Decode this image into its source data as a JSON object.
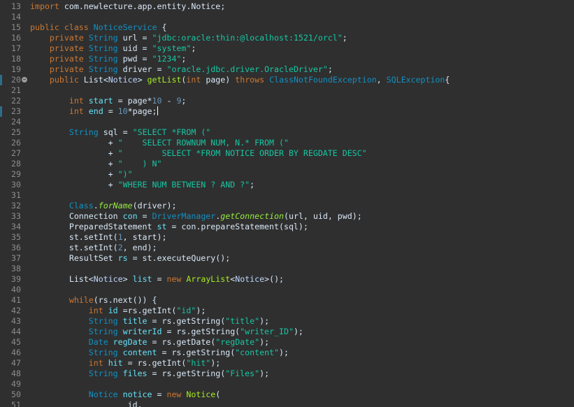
{
  "lines": [
    {
      "n": "13",
      "segs": [
        {
          "t": "import ",
          "c": "kw"
        },
        {
          "t": "com.newlecture.app.entity.Notice;",
          "c": ""
        }
      ]
    },
    {
      "n": "14",
      "segs": []
    },
    {
      "n": "15",
      "segs": [
        {
          "t": "public class ",
          "c": "kw"
        },
        {
          "t": "NoticeService",
          "c": "ty"
        },
        {
          "t": " {",
          "c": ""
        }
      ]
    },
    {
      "n": "16",
      "segs": [
        {
          "t": "    private ",
          "c": "kw"
        },
        {
          "t": "String",
          "c": "ty"
        },
        {
          "t": " url = ",
          "c": ""
        },
        {
          "t": "\"jdbc:oracle:thin:@localhost:1521/orcl\"",
          "c": "str"
        },
        {
          "t": ";",
          "c": ""
        }
      ]
    },
    {
      "n": "17",
      "segs": [
        {
          "t": "    private ",
          "c": "kw"
        },
        {
          "t": "String",
          "c": "ty"
        },
        {
          "t": " uid = ",
          "c": ""
        },
        {
          "t": "\"system\"",
          "c": "str"
        },
        {
          "t": ";",
          "c": ""
        }
      ]
    },
    {
      "n": "18",
      "segs": [
        {
          "t": "    private ",
          "c": "kw"
        },
        {
          "t": "String",
          "c": "ty"
        },
        {
          "t": " pwd = ",
          "c": ""
        },
        {
          "t": "\"1234\"",
          "c": "str"
        },
        {
          "t": ";",
          "c": ""
        }
      ]
    },
    {
      "n": "19",
      "segs": [
        {
          "t": "    private ",
          "c": "kw"
        },
        {
          "t": "String",
          "c": "ty"
        },
        {
          "t": " driver = ",
          "c": ""
        },
        {
          "t": "\"oracle.jdbc.driver.OracleDriver\"",
          "c": "str"
        },
        {
          "t": ";",
          "c": ""
        }
      ]
    },
    {
      "n": "20",
      "segs": [
        {
          "t": "    public ",
          "c": "kw"
        },
        {
          "t": "List<",
          "c": ""
        },
        {
          "t": "Notice",
          "c": "gen"
        },
        {
          "t": "> ",
          "c": ""
        },
        {
          "t": "getList",
          "c": "fn"
        },
        {
          "t": "(",
          "c": ""
        },
        {
          "t": "int",
          "c": "kw"
        },
        {
          "t": " page) ",
          "c": ""
        },
        {
          "t": "throws ",
          "c": "kw"
        },
        {
          "t": "ClassNotFoundException",
          "c": "ty"
        },
        {
          "t": ", ",
          "c": ""
        },
        {
          "t": "SQLException",
          "c": "ty"
        },
        {
          "t": "{",
          "c": ""
        }
      ]
    },
    {
      "n": "21",
      "segs": []
    },
    {
      "n": "22",
      "segs": [
        {
          "t": "        int ",
          "c": "kw"
        },
        {
          "t": "start",
          "c": "var"
        },
        {
          "t": " = page*",
          "c": ""
        },
        {
          "t": "10",
          "c": "num"
        },
        {
          "t": " - ",
          "c": ""
        },
        {
          "t": "9",
          "c": "num"
        },
        {
          "t": ";",
          "c": ""
        }
      ]
    },
    {
      "n": "23",
      "segs": [
        {
          "t": "        int ",
          "c": "kw"
        },
        {
          "t": "end",
          "c": "var"
        },
        {
          "t": " = ",
          "c": ""
        },
        {
          "t": "10",
          "c": "num"
        },
        {
          "t": "*page;",
          "c": ""
        }
      ]
    },
    {
      "n": "24",
      "segs": []
    },
    {
      "n": "25",
      "segs": [
        {
          "t": "        String",
          "c": "ty"
        },
        {
          "t": " sql = ",
          "c": ""
        },
        {
          "t": "\"SELECT *FROM (\"",
          "c": "str"
        }
      ]
    },
    {
      "n": "26",
      "segs": [
        {
          "t": "                + ",
          "c": ""
        },
        {
          "t": "\"    SELECT ROWNUM NUM, N.* FROM (\"",
          "c": "str"
        }
      ]
    },
    {
      "n": "27",
      "segs": [
        {
          "t": "                + ",
          "c": ""
        },
        {
          "t": "\"        SELECT *FROM NOTICE ORDER BY REGDATE DESC\"",
          "c": "str"
        }
      ]
    },
    {
      "n": "28",
      "segs": [
        {
          "t": "                + ",
          "c": ""
        },
        {
          "t": "\"    ) N\"",
          "c": "str"
        }
      ]
    },
    {
      "n": "29",
      "segs": [
        {
          "t": "                + ",
          "c": ""
        },
        {
          "t": "\")\"",
          "c": "str"
        }
      ]
    },
    {
      "n": "30",
      "segs": [
        {
          "t": "                + ",
          "c": ""
        },
        {
          "t": "\"WHERE NUM BETWEEN ? AND ?\"",
          "c": "str"
        },
        {
          "t": ";",
          "c": ""
        }
      ]
    },
    {
      "n": "31",
      "segs": []
    },
    {
      "n": "32",
      "segs": [
        {
          "t": "        Class",
          "c": "ty"
        },
        {
          "t": ".",
          "c": ""
        },
        {
          "t": "forName",
          "c": "fn-i"
        },
        {
          "t": "(driver);",
          "c": ""
        }
      ]
    },
    {
      "n": "33",
      "segs": [
        {
          "t": "        Connection ",
          "c": ""
        },
        {
          "t": "con",
          "c": "var"
        },
        {
          "t": " = ",
          "c": ""
        },
        {
          "t": "DriverManager",
          "c": "ty"
        },
        {
          "t": ".",
          "c": ""
        },
        {
          "t": "getConnection",
          "c": "fn-i"
        },
        {
          "t": "(url, uid, pwd);",
          "c": ""
        }
      ]
    },
    {
      "n": "34",
      "segs": [
        {
          "t": "        PreparedStatement ",
          "c": ""
        },
        {
          "t": "st",
          "c": "var"
        },
        {
          "t": " = con.prepareStatement(sql);",
          "c": ""
        }
      ]
    },
    {
      "n": "35",
      "segs": [
        {
          "t": "        st.setInt(",
          "c": ""
        },
        {
          "t": "1",
          "c": "num"
        },
        {
          "t": ", start);",
          "c": ""
        }
      ]
    },
    {
      "n": "36",
      "segs": [
        {
          "t": "        st.setInt(",
          "c": ""
        },
        {
          "t": "2",
          "c": "num"
        },
        {
          "t": ", end);",
          "c": ""
        }
      ]
    },
    {
      "n": "37",
      "segs": [
        {
          "t": "        ResultSet ",
          "c": ""
        },
        {
          "t": "rs",
          "c": "var"
        },
        {
          "t": " = st.executeQuery();",
          "c": ""
        }
      ]
    },
    {
      "n": "38",
      "segs": []
    },
    {
      "n": "39",
      "segs": [
        {
          "t": "        List<",
          "c": ""
        },
        {
          "t": "Notice",
          "c": "gen"
        },
        {
          "t": "> ",
          "c": ""
        },
        {
          "t": "list",
          "c": "var"
        },
        {
          "t": " = ",
          "c": ""
        },
        {
          "t": "new ",
          "c": "kw"
        },
        {
          "t": "ArrayList",
          "c": "fn"
        },
        {
          "t": "<",
          "c": ""
        },
        {
          "t": "Notice",
          "c": "gen"
        },
        {
          "t": ">();",
          "c": ""
        }
      ]
    },
    {
      "n": "40",
      "segs": []
    },
    {
      "n": "41",
      "segs": [
        {
          "t": "        while",
          "c": "kw"
        },
        {
          "t": "(rs.next()) {",
          "c": ""
        }
      ]
    },
    {
      "n": "42",
      "segs": [
        {
          "t": "            int ",
          "c": "kw"
        },
        {
          "t": "id",
          "c": "var"
        },
        {
          "t": " =rs.getInt(",
          "c": ""
        },
        {
          "t": "\"id\"",
          "c": "str"
        },
        {
          "t": ");",
          "c": ""
        }
      ]
    },
    {
      "n": "43",
      "segs": [
        {
          "t": "            String",
          "c": "ty"
        },
        {
          "t": " ",
          "c": ""
        },
        {
          "t": "title",
          "c": "var"
        },
        {
          "t": " = rs.getString(",
          "c": ""
        },
        {
          "t": "\"title\"",
          "c": "str"
        },
        {
          "t": ");",
          "c": ""
        }
      ]
    },
    {
      "n": "44",
      "segs": [
        {
          "t": "            String",
          "c": "ty"
        },
        {
          "t": " ",
          "c": ""
        },
        {
          "t": "writerId",
          "c": "var"
        },
        {
          "t": " = rs.getString(",
          "c": ""
        },
        {
          "t": "\"writer_ID\"",
          "c": "str"
        },
        {
          "t": ");",
          "c": ""
        }
      ]
    },
    {
      "n": "45",
      "segs": [
        {
          "t": "            Date",
          "c": "ty"
        },
        {
          "t": " ",
          "c": ""
        },
        {
          "t": "regDate",
          "c": "var"
        },
        {
          "t": " = rs.getDate(",
          "c": ""
        },
        {
          "t": "\"regDate\"",
          "c": "str"
        },
        {
          "t": ");",
          "c": ""
        }
      ]
    },
    {
      "n": "46",
      "segs": [
        {
          "t": "            String",
          "c": "ty"
        },
        {
          "t": " ",
          "c": ""
        },
        {
          "t": "content",
          "c": "var"
        },
        {
          "t": " = rs.getString(",
          "c": ""
        },
        {
          "t": "\"content\"",
          "c": "str"
        },
        {
          "t": ");",
          "c": ""
        }
      ]
    },
    {
      "n": "47",
      "segs": [
        {
          "t": "            int ",
          "c": "kw"
        },
        {
          "t": "hit",
          "c": "var"
        },
        {
          "t": " = rs.getInt(",
          "c": ""
        },
        {
          "t": "\"hit\"",
          "c": "str"
        },
        {
          "t": ");",
          "c": ""
        }
      ]
    },
    {
      "n": "48",
      "segs": [
        {
          "t": "            String",
          "c": "ty"
        },
        {
          "t": " ",
          "c": ""
        },
        {
          "t": "files",
          "c": "var"
        },
        {
          "t": " = rs.getString(",
          "c": ""
        },
        {
          "t": "\"Files\"",
          "c": "str"
        },
        {
          "t": ");",
          "c": ""
        }
      ]
    },
    {
      "n": "49",
      "segs": []
    },
    {
      "n": "50",
      "segs": [
        {
          "t": "            Notice",
          "c": "ty"
        },
        {
          "t": " ",
          "c": ""
        },
        {
          "t": "notice",
          "c": "var"
        },
        {
          "t": " = ",
          "c": ""
        },
        {
          "t": "new ",
          "c": "kw"
        },
        {
          "t": "Notice",
          "c": "fn"
        },
        {
          "t": "(",
          "c": ""
        }
      ]
    },
    {
      "n": "51",
      "segs": [
        {
          "t": "                    id,",
          "c": ""
        }
      ]
    }
  ],
  "fold_marker_line": "20",
  "cursor_line": "23",
  "changed_lines": [
    "20",
    "23"
  ]
}
